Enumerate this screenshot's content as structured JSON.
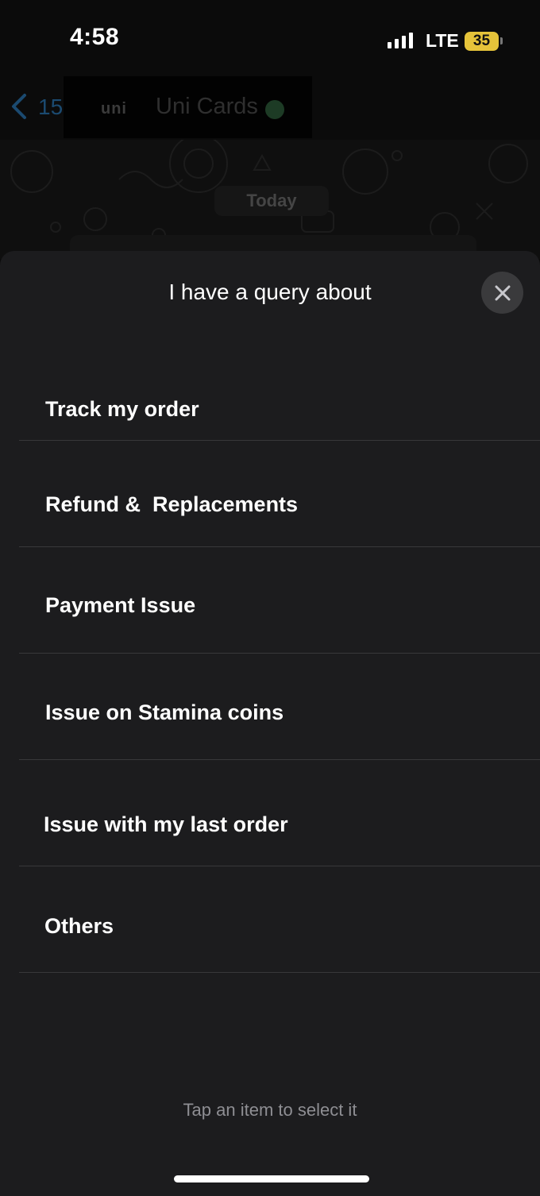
{
  "status_bar": {
    "time": "4:58",
    "network": "LTE",
    "battery": "35"
  },
  "chat_header": {
    "back_count": "15",
    "logo": "uni",
    "contact_name": "Uni Cards"
  },
  "chat": {
    "date_label": "Today"
  },
  "sheet": {
    "title": "I have a query about",
    "options": [
      "Track my order",
      "Refund &  Replacements",
      "Payment Issue",
      "Issue on Stamina coins",
      "Issue with my last order",
      "Others"
    ],
    "hint": "Tap an item to select it"
  },
  "icons": {
    "close": "close-icon",
    "back": "chevron-left-icon",
    "signal": "signal-icon",
    "verified": "verified-icon"
  },
  "colors": {
    "sheet_bg": "#1c1c1e",
    "battery": "#e5c33a",
    "divider": "#38383a"
  }
}
